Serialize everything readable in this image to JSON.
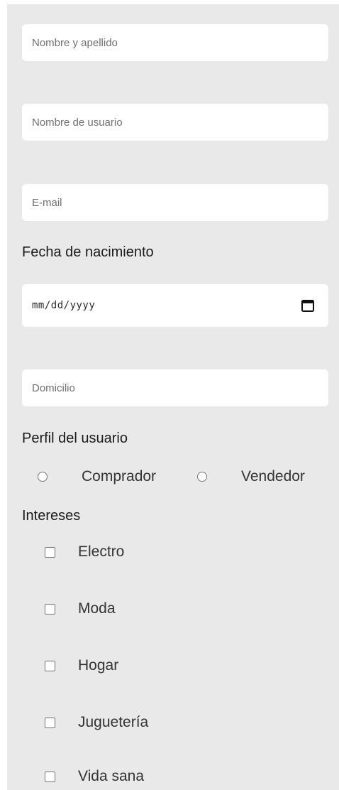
{
  "form": {
    "fields": {
      "full_name": {
        "placeholder": "Nombre y apellido"
      },
      "username": {
        "placeholder": "Nombre de usuario"
      },
      "email": {
        "placeholder": "E-mail"
      },
      "address": {
        "placeholder": "Domicilio"
      }
    },
    "birth_date": {
      "label": "Fecha de nacimiento",
      "placeholder": "mm/dd/yyyy",
      "icon": "calendar-icon"
    },
    "profile": {
      "label": "Perfil del usuario",
      "options": [
        "Comprador",
        "Vendedor"
      ]
    },
    "interests": {
      "label": "Intereses",
      "options": [
        "Electro",
        "Moda",
        "Hogar",
        "Juguetería",
        "Vida sana"
      ]
    }
  }
}
